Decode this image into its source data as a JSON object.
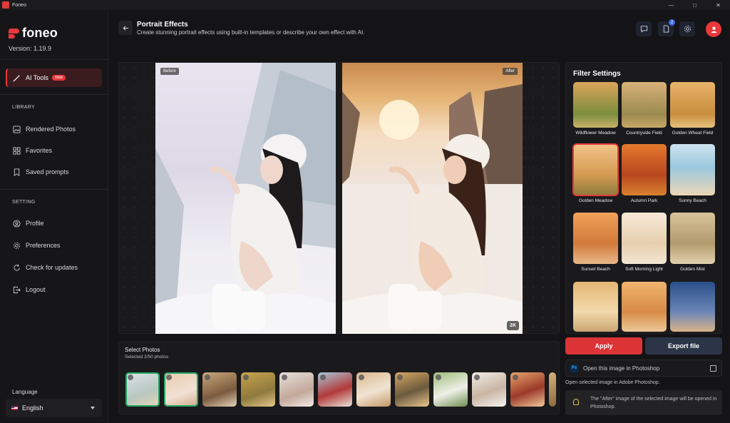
{
  "window": {
    "title": "Foneo",
    "controls": [
      "—",
      "□",
      "✕"
    ]
  },
  "sidebar": {
    "logo_text": "foneo",
    "version": "Version: 1.19.9",
    "ai_tools": {
      "label": "AI Tools",
      "badge": "new"
    },
    "library_heading": "LIBRARY",
    "library_items": [
      "Rendered Photos",
      "Favorites",
      "Saved prompts"
    ],
    "setting_heading": "SETTING",
    "setting_items": [
      "Profile",
      "Preferences",
      "Check for updates",
      "Logout"
    ],
    "language_label": "Language",
    "language_value": "English"
  },
  "header": {
    "title": "Portrait Effects",
    "subtitle": "Create stunning portrait effects using built-in templates or describe your own effect with AI.",
    "notification_count": "2"
  },
  "compare": {
    "before_label": "Before",
    "after_label": "After",
    "resolution_badge": "2K"
  },
  "select_photos": {
    "title": "Select Photos",
    "subtitle": "Selected 2/50 photos"
  },
  "filter_settings": {
    "title": "Filter Settings",
    "filters": [
      "Wildflower Meadow",
      "Countryside Field",
      "Golden Wheat Field",
      "Golden Meadow",
      "Autumn Park",
      "Sunny Beach",
      "Sunset Beach",
      "Soft Morning Light",
      "Golden Mist"
    ],
    "selected": "Golden Meadow"
  },
  "actions": {
    "apply_label": "Apply",
    "export_label": "Export file",
    "photoshop_badge": "Ps",
    "photoshop_label": "Open this image in Photoshop",
    "photoshop_help": "Open selected image in Adobe Photoshop.",
    "note": "The \"After\" image of the selected image will be opened in Photoshop."
  },
  "colors": {
    "accent": "#e8383a",
    "selected_outline": "#24a866",
    "export_bg": "#2c3548"
  }
}
